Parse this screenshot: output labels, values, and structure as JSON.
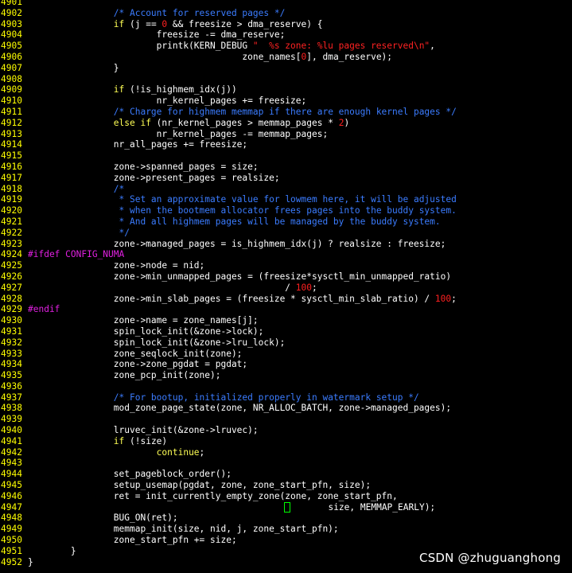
{
  "watermark": "CSDN @zhuguanghong",
  "colors": {
    "background": "#000000",
    "line_number": "#ffff00",
    "keyword": "#ffff55",
    "comment": "#3b7cff",
    "number": "#ff2020",
    "string": "#ff2222",
    "preprocessor": "#e020e0",
    "cursor": "#00ff00"
  },
  "lines": [
    {
      "n": "4901",
      "segs": []
    },
    {
      "n": "4902",
      "segs": [
        [
          "pl",
          "\t\t"
        ],
        [
          "cm",
          "/* Account for reserved pages */"
        ]
      ]
    },
    {
      "n": "4903",
      "segs": [
        [
          "pl",
          "\t\t"
        ],
        [
          "kw",
          "if"
        ],
        [
          "pl",
          " (j == "
        ],
        [
          "num",
          "0"
        ],
        [
          "pl",
          " && freesize > dma_reserve) {"
        ]
      ]
    },
    {
      "n": "4904",
      "segs": [
        [
          "pl",
          "\t\t\tfreesize -= dma_reserve;"
        ]
      ]
    },
    {
      "n": "4905",
      "segs": [
        [
          "pl",
          "\t\t\tprintk(KERN_DEBUG "
        ],
        [
          "str",
          "\"  %s zone: %lu pages reserved\\n\""
        ],
        [
          "pl",
          ","
        ]
      ]
    },
    {
      "n": "4906",
      "segs": [
        [
          "pl",
          "\t\t\t\t\tzone_names["
        ],
        [
          "num",
          "0"
        ],
        [
          "pl",
          "], dma_reserve);"
        ]
      ]
    },
    {
      "n": "4907",
      "segs": [
        [
          "pl",
          "\t\t}"
        ]
      ]
    },
    {
      "n": "4908",
      "segs": []
    },
    {
      "n": "4909",
      "segs": [
        [
          "pl",
          "\t\t"
        ],
        [
          "kw",
          "if"
        ],
        [
          "pl",
          " (!is_highmem_idx(j))"
        ]
      ]
    },
    {
      "n": "4910",
      "segs": [
        [
          "pl",
          "\t\t\tnr_kernel_pages += freesize;"
        ]
      ]
    },
    {
      "n": "4911",
      "segs": [
        [
          "pl",
          "\t\t"
        ],
        [
          "cm",
          "/* Charge for highmem memmap if there are enough kernel pages */"
        ]
      ]
    },
    {
      "n": "4912",
      "segs": [
        [
          "pl",
          "\t\t"
        ],
        [
          "kw",
          "else if"
        ],
        [
          "pl",
          " (nr_kernel_pages > memmap_pages * "
        ],
        [
          "num",
          "2"
        ],
        [
          "pl",
          ")"
        ]
      ]
    },
    {
      "n": "4913",
      "segs": [
        [
          "pl",
          "\t\t\tnr_kernel_pages -= memmap_pages;"
        ]
      ]
    },
    {
      "n": "4914",
      "segs": [
        [
          "pl",
          "\t\tnr_all_pages += freesize;"
        ]
      ]
    },
    {
      "n": "4915",
      "segs": []
    },
    {
      "n": "4916",
      "segs": [
        [
          "pl",
          "\t\tzone->spanned_pages = size;"
        ]
      ]
    },
    {
      "n": "4917",
      "segs": [
        [
          "pl",
          "\t\tzone->present_pages = realsize;"
        ]
      ]
    },
    {
      "n": "4918",
      "segs": [
        [
          "pl",
          "\t\t"
        ],
        [
          "cm",
          "/*"
        ]
      ]
    },
    {
      "n": "4919",
      "segs": [
        [
          "pl",
          "\t\t"
        ],
        [
          "cm",
          " * Set an approximate value for lowmem here, it will be adjusted"
        ]
      ]
    },
    {
      "n": "4920",
      "segs": [
        [
          "pl",
          "\t\t"
        ],
        [
          "cm",
          " * when the bootmem allocator frees pages into the buddy system."
        ]
      ]
    },
    {
      "n": "4921",
      "segs": [
        [
          "pl",
          "\t\t"
        ],
        [
          "cm",
          " * And all highmem pages will be managed by the buddy system."
        ]
      ]
    },
    {
      "n": "4922",
      "segs": [
        [
          "pl",
          "\t\t"
        ],
        [
          "cm",
          " */"
        ]
      ]
    },
    {
      "n": "4923",
      "segs": [
        [
          "pl",
          "\t\tzone->managed_pages = is_highmem_idx(j) ? realsize : freesize;"
        ]
      ]
    },
    {
      "n": "4924",
      "segs": [
        [
          "pp",
          "#ifdef CONFIG_NUMA"
        ]
      ]
    },
    {
      "n": "4925",
      "segs": [
        [
          "pl",
          "\t\tzone->node = nid;"
        ]
      ]
    },
    {
      "n": "4926",
      "segs": [
        [
          "pl",
          "\t\tzone->min_unmapped_pages = (freesize*sysctl_min_unmapped_ratio)"
        ]
      ]
    },
    {
      "n": "4927",
      "segs": [
        [
          "pl",
          "\t\t\t\t\t\t/ "
        ],
        [
          "num",
          "100"
        ],
        [
          "pl",
          ";"
        ]
      ]
    },
    {
      "n": "4928",
      "segs": [
        [
          "pl",
          "\t\tzone->min_slab_pages = (freesize * sysctl_min_slab_ratio) / "
        ],
        [
          "num",
          "100"
        ],
        [
          "pl",
          ";"
        ]
      ]
    },
    {
      "n": "4929",
      "segs": [
        [
          "pp",
          "#endif"
        ]
      ]
    },
    {
      "n": "4930",
      "segs": [
        [
          "pl",
          "\t\tzone->name = zone_names[j];"
        ]
      ]
    },
    {
      "n": "4931",
      "segs": [
        [
          "pl",
          "\t\tspin_lock_init(&zone->lock);"
        ]
      ]
    },
    {
      "n": "4932",
      "segs": [
        [
          "pl",
          "\t\tspin_lock_init(&zone->lru_lock);"
        ]
      ]
    },
    {
      "n": "4933",
      "segs": [
        [
          "pl",
          "\t\tzone_seqlock_init(zone);"
        ]
      ]
    },
    {
      "n": "4934",
      "segs": [
        [
          "pl",
          "\t\tzone->zone_pgdat = pgdat;"
        ]
      ]
    },
    {
      "n": "4935",
      "segs": [
        [
          "pl",
          "\t\tzone_pcp_init(zone);"
        ]
      ]
    },
    {
      "n": "4936",
      "segs": []
    },
    {
      "n": "4937",
      "segs": [
        [
          "pl",
          "\t\t"
        ],
        [
          "cm",
          "/* For bootup, initialized properly in watermark setup */"
        ]
      ]
    },
    {
      "n": "4938",
      "segs": [
        [
          "pl",
          "\t\tmod_zone_page_state(zone, NR_ALLOC_BATCH, zone->managed_pages);"
        ]
      ]
    },
    {
      "n": "4939",
      "segs": []
    },
    {
      "n": "4940",
      "segs": [
        [
          "pl",
          "\t\tlruvec_init(&zone->lruvec);"
        ]
      ]
    },
    {
      "n": "4941",
      "segs": [
        [
          "pl",
          "\t\t"
        ],
        [
          "kw",
          "if"
        ],
        [
          "pl",
          " (!size)"
        ]
      ]
    },
    {
      "n": "4942",
      "segs": [
        [
          "pl",
          "\t\t\t"
        ],
        [
          "kw",
          "continue"
        ],
        [
          "pl",
          ";"
        ]
      ]
    },
    {
      "n": "4943",
      "segs": []
    },
    {
      "n": "4944",
      "segs": [
        [
          "pl",
          "\t\tset_pageblock_order();"
        ]
      ]
    },
    {
      "n": "4945",
      "segs": [
        [
          "pl",
          "\t\tsetup_usemap(pgdat, zone, zone_start_pfn, size);"
        ]
      ]
    },
    {
      "n": "4946",
      "segs": [
        [
          "pl",
          "\t\tret = init_currently_empty_zone(zone, zone_start_pfn,"
        ]
      ]
    },
    {
      "n": "4947",
      "segs": [
        [
          "pl",
          "\t\t\t\t\t\t"
        ],
        [
          "cursor",
          ""
        ],
        [
          "pl",
          "       size, MEMMAP_EARLY);"
        ]
      ]
    },
    {
      "n": "4948",
      "segs": [
        [
          "pl",
          "\t\tBUG_ON(ret);"
        ]
      ]
    },
    {
      "n": "4949",
      "segs": [
        [
          "pl",
          "\t\tmemmap_init(size, nid, j, zone_start_pfn);"
        ]
      ]
    },
    {
      "n": "4950",
      "segs": [
        [
          "pl",
          "\t\tzone_start_pfn += size;"
        ]
      ]
    },
    {
      "n": "4951",
      "segs": [
        [
          "pl",
          "\t}"
        ]
      ]
    },
    {
      "n": "4952",
      "segs": [
        [
          "pl",
          "}"
        ]
      ]
    }
  ]
}
